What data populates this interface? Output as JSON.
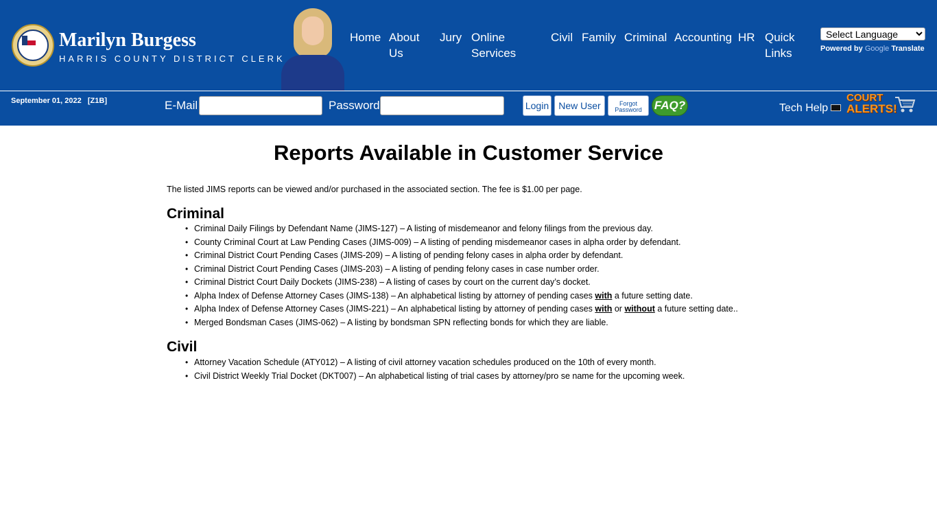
{
  "header": {
    "brand_name": "Marilyn Burgess",
    "brand_sub": "HARRIS COUNTY DISTRICT CLERK",
    "nav": [
      "Home",
      "About Us",
      "Jury",
      "Online Services",
      "Civil",
      "Family",
      "Criminal",
      "Accounting",
      "HR",
      "Quick Links"
    ],
    "language_select": "Select Language",
    "powered_by": "Powered by",
    "google": "Google",
    "translate": "Translate"
  },
  "login": {
    "date": "September 01, 2022   [Z1B]",
    "email_label": "E-Mail",
    "password_label": "Password",
    "login_button": "Login",
    "new_user_button": "New User",
    "forgot_line1": "Forgot",
    "forgot_line2": "Password",
    "faq": "FAQ?",
    "tech_help": "Tech Help",
    "court_alerts_1": "COURT",
    "court_alerts_2": "ALERTS!"
  },
  "main": {
    "title": "Reports Available in Customer Service",
    "intro": "The listed JIMS reports can be viewed and/or purchased in the associated section. The fee is $1.00 per page.",
    "criminal_heading": "Criminal",
    "criminal_items": [
      "Criminal Daily Filings by Defendant Name (JIMS-127) – A listing of misdemeanor and felony filings from the previous day.",
      "County Criminal Court at Law Pending Cases (JIMS-009) – A listing of pending misdemeanor cases in alpha order by defendant.",
      "Criminal District Court Pending Cases (JIMS-209) – A listing of pending felony cases in alpha order by defendant.",
      "Criminal District Court Pending Cases (JIMS-203) – A listing of pending felony cases in case number order.",
      "Criminal District Court Daily Dockets (JIMS-238) – A listing of cases by court on the current day’s docket."
    ],
    "item6_pre": "Alpha Index of Defense Attorney Cases (JIMS-138) – An alphabetical listing by attorney of pending cases ",
    "item6_em": "with",
    "item6_post": " a future setting date.",
    "item7_pre": "Alpha Index of Defense Attorney Cases (JIMS-221) – An alphabetical listing by attorney of pending cases ",
    "item7_em1": "with",
    "item7_mid": " or ",
    "item7_em2": "without",
    "item7_post": " a future setting date..",
    "item8": "Merged Bondsman Cases (JIMS-062) – A listing by bondsman SPN reflecting bonds for which they are liable.",
    "civil_heading": "Civil",
    "civil_items": [
      "Attorney Vacation Schedule (ATY012) – A listing of civil attorney vacation schedules produced on the 10th of every month.",
      "Civil District Weekly Trial Docket (DKT007) – An alphabetical listing of trial cases by attorney/pro se name for the upcoming week."
    ]
  }
}
